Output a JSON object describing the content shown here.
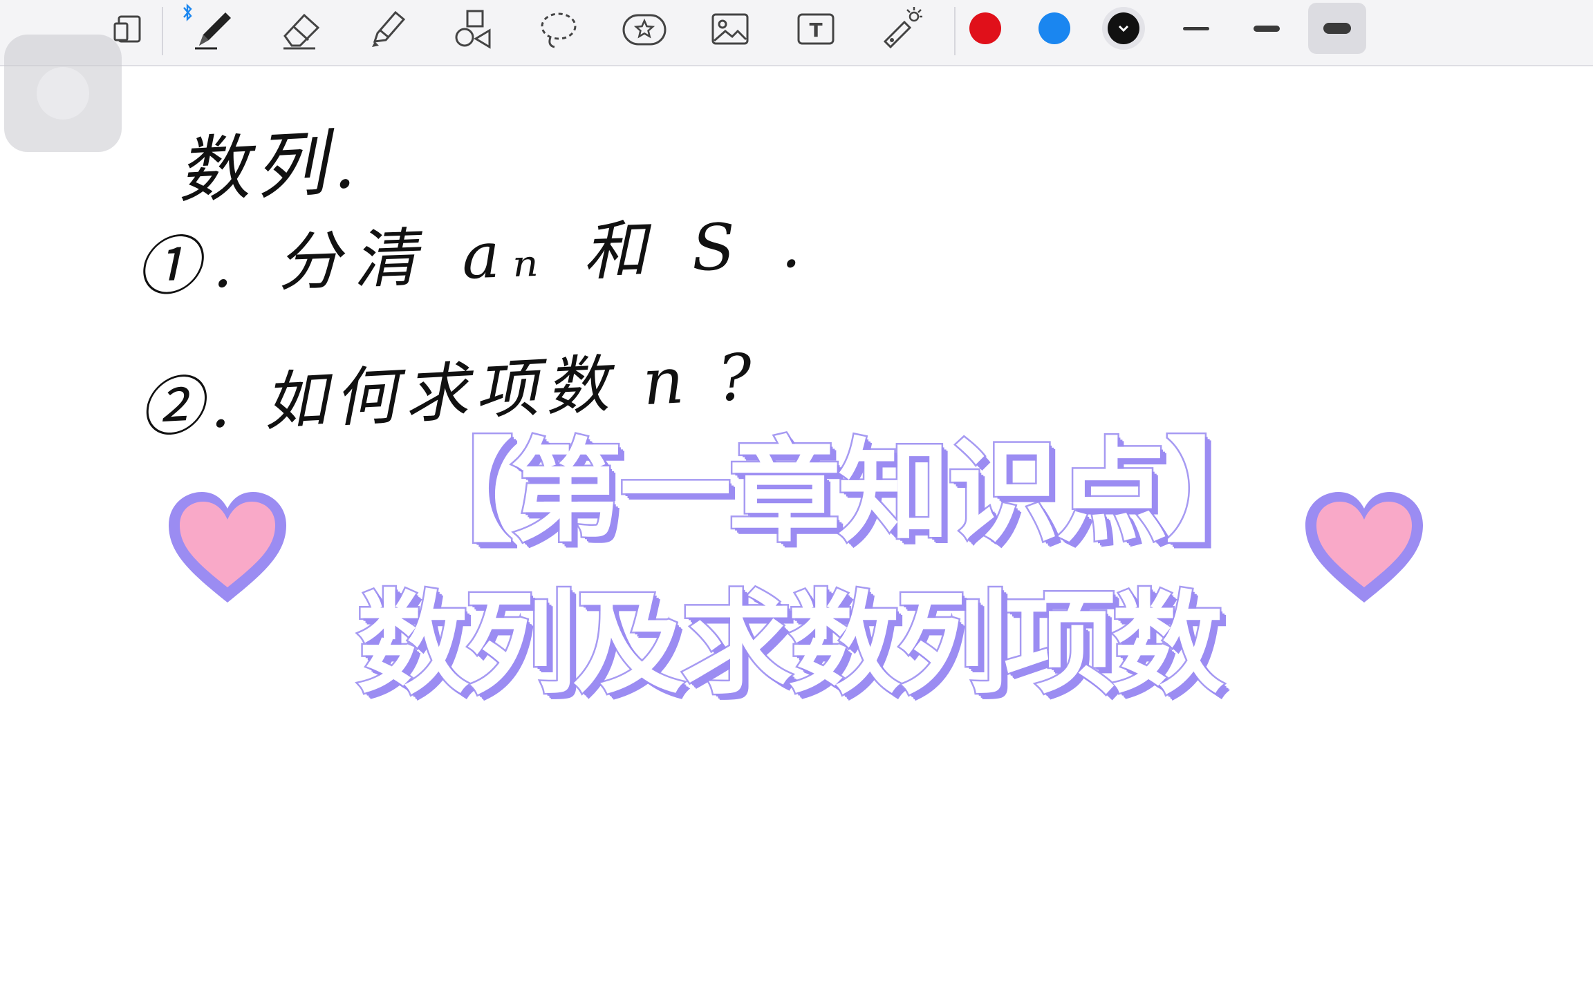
{
  "toolbar": {
    "tools": [
      {
        "id": "pages",
        "icon": "pages-icon"
      },
      {
        "id": "pen",
        "icon": "pen-icon",
        "active": true
      },
      {
        "id": "eraser",
        "icon": "eraser-icon"
      },
      {
        "id": "highlighter",
        "icon": "highlighter-icon"
      },
      {
        "id": "shapes",
        "icon": "shapes-icon"
      },
      {
        "id": "lasso",
        "icon": "lasso-icon"
      },
      {
        "id": "sticker",
        "icon": "sticker-star-icon"
      },
      {
        "id": "image",
        "icon": "image-icon"
      },
      {
        "id": "text",
        "icon": "text-box-icon",
        "glyph": "T"
      },
      {
        "id": "laser",
        "icon": "laser-pointer-icon"
      }
    ],
    "bluetooth_icon": "bluetooth-icon",
    "colors": [
      {
        "name": "red",
        "hex": "#e0101a"
      },
      {
        "name": "blue",
        "hex": "#1a86f0"
      },
      {
        "name": "black",
        "hex": "#111111",
        "selected": true
      }
    ],
    "stroke_widths": [
      "thin",
      "medium",
      "thick"
    ],
    "selected_stroke": "thick"
  },
  "notes": {
    "title": "数列.",
    "line1": "①. 分清 aₙ 和 S .",
    "line2": "②. 如何求项数 n ?"
  },
  "banner": {
    "line1": "【第一章知识点】",
    "line2": "数列及求数列项数",
    "text_color": "#ffffff",
    "outline_color": "#9b8cf2"
  },
  "decor": {
    "heart_fill": "#f9a9c8",
    "heart_outline": "#9b8cf2"
  }
}
